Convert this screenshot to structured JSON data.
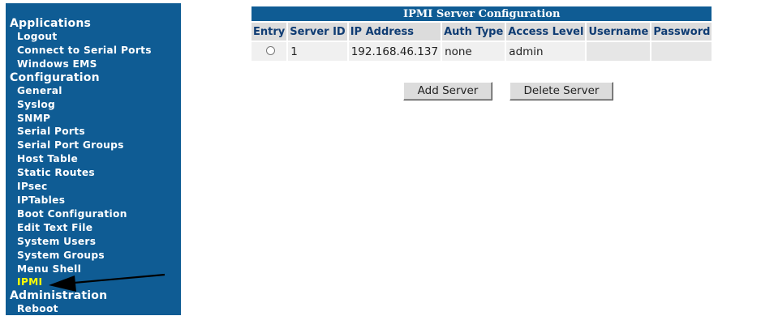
{
  "sidebar": {
    "sections": [
      {
        "title": "Applications",
        "items": [
          "Logout",
          "Connect to Serial Ports",
          "Windows EMS"
        ]
      },
      {
        "title": "Configuration",
        "items": [
          "General",
          "Syslog",
          "SNMP",
          "Serial Ports",
          "Serial Port Groups",
          "Host Table",
          "Static Routes",
          "IPsec",
          "IPTables",
          "Boot Configuration",
          "Edit Text File",
          "System Users",
          "System Groups",
          "Menu Shell",
          "IPMI"
        ]
      },
      {
        "title": "Administration",
        "items": [
          "Reboot"
        ]
      }
    ],
    "active_item": "IPMI"
  },
  "table": {
    "title": "IPMI Server Configuration",
    "columns": [
      "Entry",
      "Server ID",
      "IP Address",
      "Auth Type",
      "Access Level",
      "Username",
      "Password"
    ],
    "rows": [
      {
        "server_id": "1",
        "ip": "192.168.46.137",
        "auth": "none",
        "access": "admin",
        "username": "",
        "password": ""
      }
    ]
  },
  "buttons": {
    "add": "Add Server",
    "delete": "Delete Server"
  },
  "colors": {
    "sidebar_bg": "#0f5c94",
    "active_link": "#ffff00",
    "header_text": "#0f3c73"
  }
}
